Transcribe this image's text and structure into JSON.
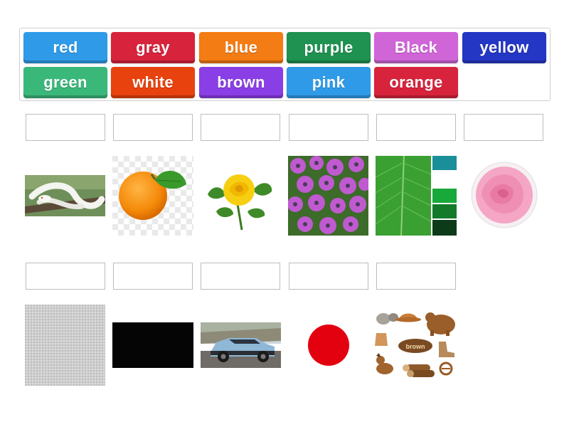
{
  "word_tiles": [
    {
      "label": "red",
      "color": "#2f9be8"
    },
    {
      "label": "gray",
      "color": "#d8233c"
    },
    {
      "label": "blue",
      "color": "#f47c14"
    },
    {
      "label": "purple",
      "color": "#1f9150"
    },
    {
      "label": "Black",
      "color": "#d065d8"
    },
    {
      "label": "yellow",
      "color": "#2436c4"
    },
    {
      "label": "green",
      "color": "#3ab87a"
    },
    {
      "label": "white",
      "color": "#e8420e"
    },
    {
      "label": "brown",
      "color": "#8a3ee6"
    },
    {
      "label": "pink",
      "color": "#2f9be8"
    },
    {
      "label": "orange",
      "color": "#d8233c"
    }
  ],
  "row1_images": [
    "white snake",
    "orange fruit",
    "yellow rose",
    "purple flowers",
    "green leaf",
    "pink rose"
  ],
  "row2_images": [
    "gray fabric",
    "black rectangle",
    "blue car",
    "red circle",
    "brown things"
  ],
  "brown_sign_text": "brown"
}
